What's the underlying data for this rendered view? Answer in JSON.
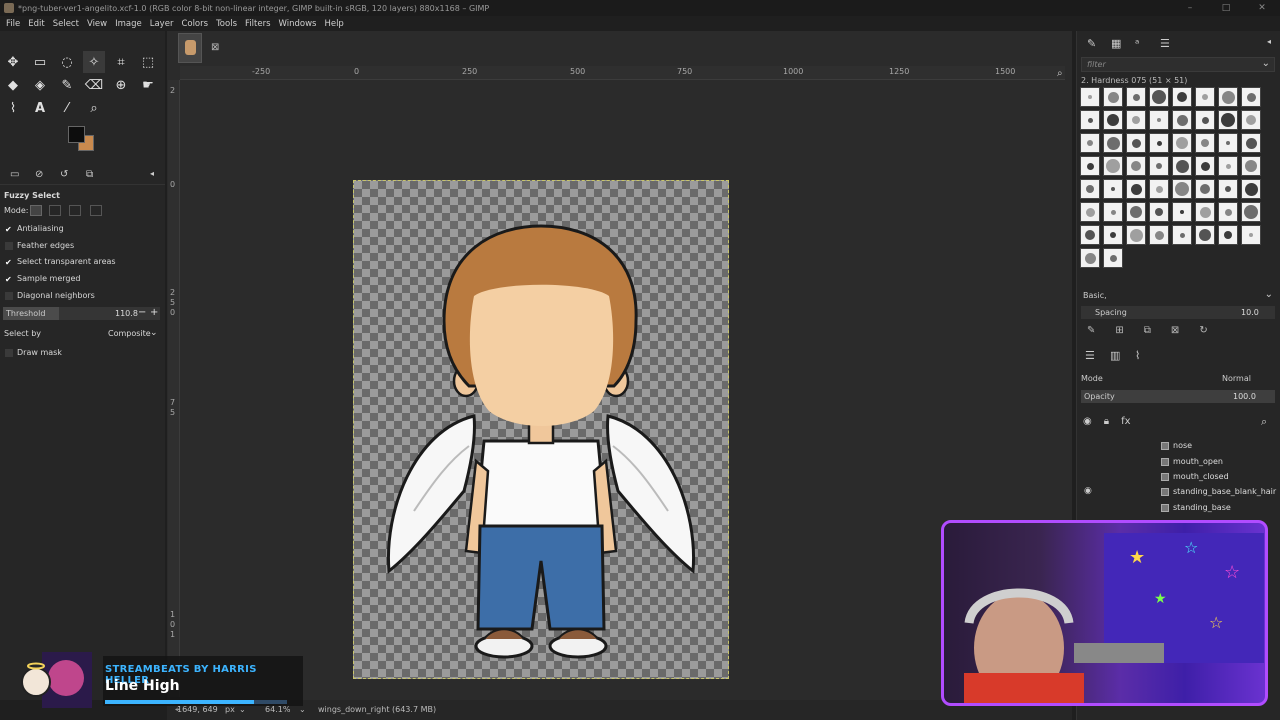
{
  "window": {
    "title": "*png-tuber-ver1-angelito.xcf-1.0 (RGB color 8-bit non-linear integer, GIMP built-in sRGB, 120 layers) 880x1168 – GIMP",
    "controls": [
      "–",
      "□",
      "✕"
    ]
  },
  "menu": [
    "File",
    "Edit",
    "Select",
    "View",
    "Image",
    "Layer",
    "Colors",
    "Tools",
    "Filters",
    "Windows",
    "Help"
  ],
  "colors": {
    "foreground": "#0d0d0d",
    "background": "#c98a4e",
    "accent": "#3cb4ff",
    "webcam_border": "#b14cff"
  },
  "tool_options": {
    "title": "Fuzzy Select",
    "mode_label": "Mode:",
    "antialiasing": "Antialiasing",
    "feather_edges": "Feather edges",
    "select_transparent": "Select transparent areas",
    "sample_merged": "Sample merged",
    "diagonal_neighbors": "Diagonal neighbors",
    "threshold_label": "Threshold",
    "threshold_value": "110.8",
    "select_by_label": "Select by",
    "select_by_value": "Composite",
    "draw_mask": "Draw mask"
  },
  "ruler": {
    "h": [
      "-250",
      "0",
      "250",
      "500",
      "750",
      "1000",
      "1250",
      "1500"
    ],
    "v": [
      "2",
      "0",
      "2",
      "5",
      "0",
      "7",
      "5",
      "1",
      "0",
      "1",
      "2",
      "5"
    ]
  },
  "status": {
    "coords": "1649, 649",
    "unit": "px",
    "zoom": "64.1%",
    "layer_info": "wings_down_right (643.7 MB)"
  },
  "brushes": {
    "filter_placeholder": "filter",
    "name": "2. Hardness 075 (51 × 51)",
    "preset": "Basic,",
    "spacing_label": "Spacing",
    "spacing_value": "10.0"
  },
  "layers": {
    "mode_label": "Mode",
    "mode_value": "Normal",
    "opacity_label": "Opacity",
    "opacity_value": "100.0",
    "items": [
      "nose",
      "mouth_open",
      "mouth_closed",
      "standing_base_blank_hair",
      "standing_base"
    ]
  },
  "overlay": {
    "artist": "STREAMBEATS BY HARRIS HELLER",
    "track": "Line High",
    "progress": 0.82
  }
}
